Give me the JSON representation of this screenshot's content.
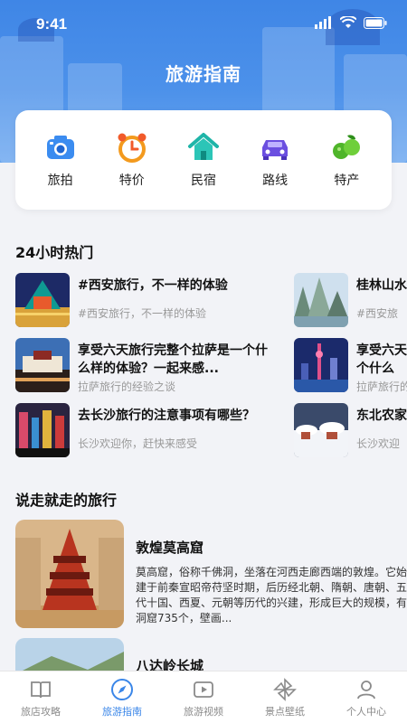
{
  "status": {
    "time": "9:41"
  },
  "header": {
    "title": "旅游指南"
  },
  "categories": [
    {
      "label": "旅拍",
      "icon": "camera-icon"
    },
    {
      "label": "特价",
      "icon": "alarm-clock-icon"
    },
    {
      "label": "民宿",
      "icon": "house-icon"
    },
    {
      "label": "路线",
      "icon": "car-icon"
    },
    {
      "label": "特产",
      "icon": "fruit-icon"
    }
  ],
  "hot": {
    "heading": "24小时热门",
    "left": [
      {
        "title": "#西安旅行，不一样的体验",
        "sub": "#西安旅行，不一样的体验"
      },
      {
        "title": "享受六天旅行完整个拉萨是一个什么样的体验？一起来感...",
        "sub": "拉萨旅行的经验之谈"
      },
      {
        "title": "去长沙旅行的注意事项有哪些？",
        "sub": "长沙欢迎你，赶快来感受"
      }
    ],
    "right": [
      {
        "title": "桂林山水",
        "sub": "#西安旅"
      },
      {
        "title": "享受六天个什么",
        "sub": "拉萨旅行的"
      },
      {
        "title": "东北农家",
        "sub": "长沙欢迎"
      }
    ]
  },
  "trips": {
    "heading": "说走就走的旅行",
    "items": [
      {
        "title": "敦煌莫高窟",
        "desc": "莫高窟，俗称千佛洞，坐落在河西走廊西端的敦煌。它始建于前秦宣昭帝苻坚时期，后历经北朝、隋朝、唐朝、五代十国、西夏、元朝等历代的兴建，形成巨大的规模，有洞窟735个，壁画..."
      },
      {
        "title": "八达岭长城",
        "desc": ""
      }
    ]
  },
  "tabs": [
    {
      "label": "旅店攻略",
      "icon": "book-icon",
      "active": false
    },
    {
      "label": "旅游指南",
      "icon": "compass-icon",
      "active": true
    },
    {
      "label": "旅游视频",
      "icon": "video-icon",
      "active": false
    },
    {
      "label": "景点壁纸",
      "icon": "pinwheel-icon",
      "active": false
    },
    {
      "label": "个人中心",
      "icon": "user-icon",
      "active": false
    }
  ],
  "colors": {
    "accent": "#3a86e8",
    "hero": "#4c91ea"
  }
}
